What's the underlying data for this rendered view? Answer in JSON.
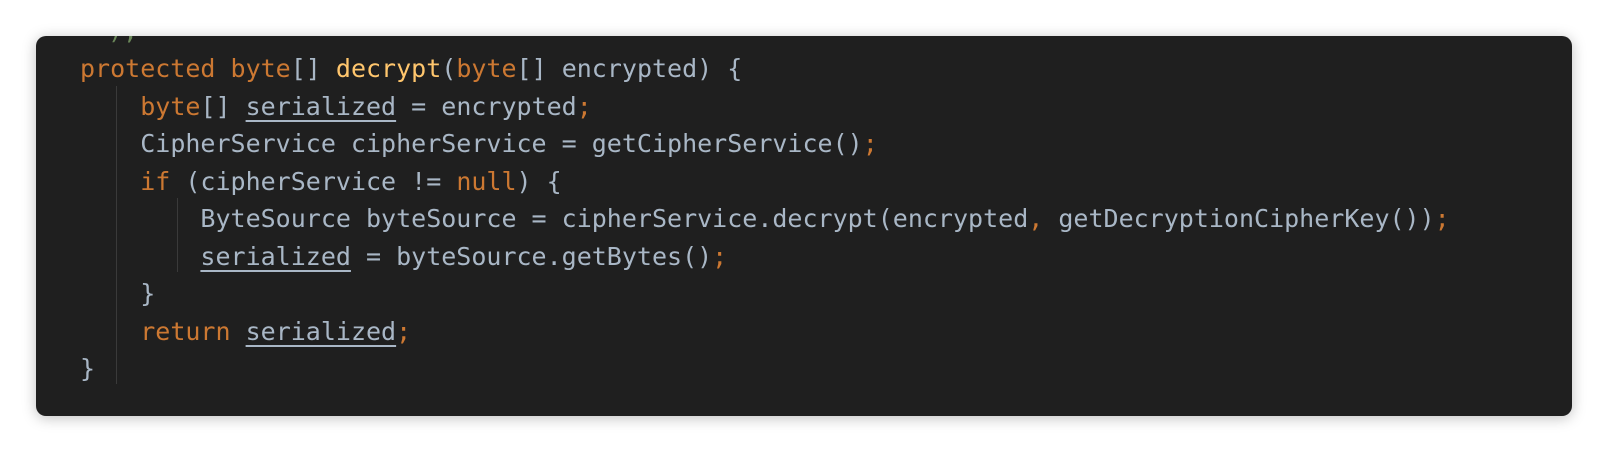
{
  "editor": {
    "partial_line": ");",
    "lines": [
      {
        "indent": "",
        "tokens": [
          {
            "t": "protected",
            "k": "kw"
          },
          {
            "t": " ",
            "k": "id"
          },
          {
            "t": "byte",
            "k": "kw"
          },
          {
            "t": "[] ",
            "k": "punct"
          },
          {
            "t": "decrypt",
            "k": "fn"
          },
          {
            "t": "(",
            "k": "punct"
          },
          {
            "t": "byte",
            "k": "kw"
          },
          {
            "t": "[] encrypted) {",
            "k": "punct"
          }
        ]
      },
      {
        "indent": "    ",
        "tokens": [
          {
            "t": "byte",
            "k": "kw"
          },
          {
            "t": "[] ",
            "k": "punct"
          },
          {
            "t": "serialized",
            "k": "var-u"
          },
          {
            "t": " = encrypted",
            "k": "id"
          },
          {
            "t": ";",
            "k": "semi"
          }
        ]
      },
      {
        "indent": "    ",
        "tokens": [
          {
            "t": "CipherService cipherService = getCipherService()",
            "k": "id"
          },
          {
            "t": ";",
            "k": "semi"
          }
        ]
      },
      {
        "indent": "    ",
        "tokens": [
          {
            "t": "if",
            "k": "kw"
          },
          {
            "t": " (cipherService != ",
            "k": "id"
          },
          {
            "t": "null",
            "k": "kw"
          },
          {
            "t": ") {",
            "k": "punct"
          }
        ]
      },
      {
        "indent": "        ",
        "tokens": [
          {
            "t": "ByteSource byteSource = cipherService.decrypt(encrypted",
            "k": "id"
          },
          {
            "t": ",",
            "k": "comma"
          },
          {
            "t": " getDecryptionCipherKey())",
            "k": "id"
          },
          {
            "t": ";",
            "k": "semi"
          }
        ]
      },
      {
        "indent": "        ",
        "tokens": [
          {
            "t": "serialized",
            "k": "var-u"
          },
          {
            "t": " = byteSource.getBytes()",
            "k": "id"
          },
          {
            "t": ";",
            "k": "semi"
          }
        ]
      },
      {
        "indent": "    ",
        "tokens": [
          {
            "t": "}",
            "k": "punct"
          }
        ]
      },
      {
        "indent": "    ",
        "tokens": [
          {
            "t": "return",
            "k": "kw"
          },
          {
            "t": " ",
            "k": "id"
          },
          {
            "t": "serialized",
            "k": "var-u"
          },
          {
            "t": ";",
            "k": "semi"
          }
        ]
      },
      {
        "indent": "",
        "tokens": [
          {
            "t": "}",
            "k": "punct"
          }
        ]
      }
    ]
  },
  "colors": {
    "background": "#1f1f1f",
    "keyword": "#cc7832",
    "function": "#ffc66d",
    "identifier": "#a9b7c6",
    "string": "#6a8759"
  }
}
